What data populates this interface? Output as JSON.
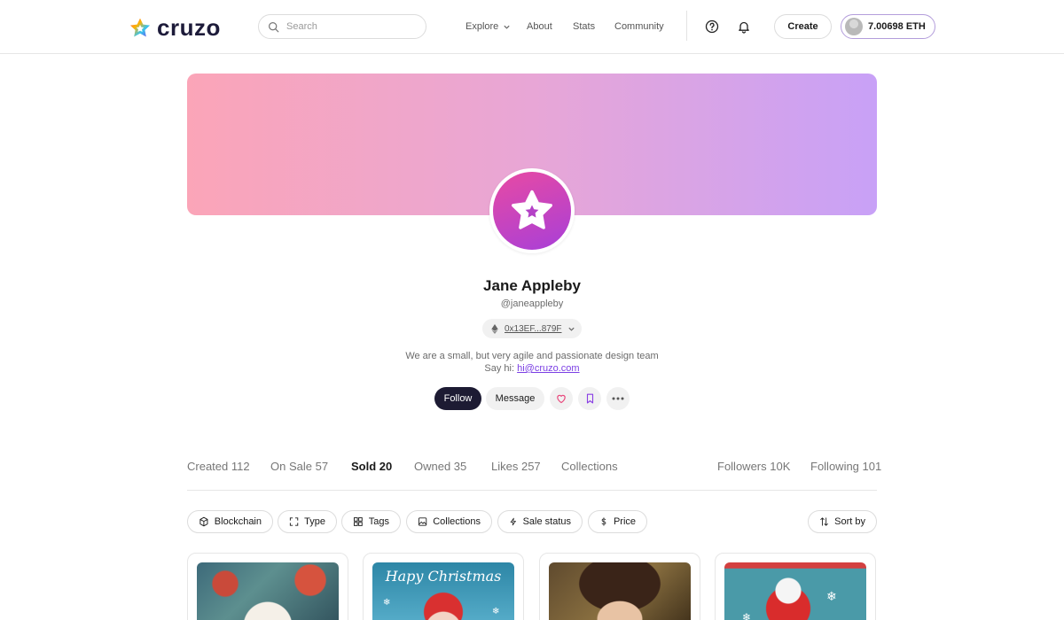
{
  "header": {
    "brand": "cruzo",
    "search_placeholder": "Search",
    "nav": {
      "explore": "Explore",
      "about": "About",
      "stats": "Stats",
      "community": "Community"
    },
    "create_label": "Create",
    "balance": "7.00698 ETH"
  },
  "profile": {
    "name": "Jane Appleby",
    "handle": "@janeappleby",
    "address": "0x13EF...879F",
    "bio_line1": "We are a small, but very agile and passionate design team",
    "bio_say_hi": "Say hi:",
    "email": "hi@cruzo.com",
    "follow_label": "Follow",
    "message_label": "Message"
  },
  "tabs": {
    "created": "Created 112",
    "on_sale": "On Sale 57",
    "sold": "Sold 20",
    "owned": "Owned 35",
    "likes": "Likes 257",
    "collections": "Collections",
    "followers": "Followers 10K",
    "following": "Following 101"
  },
  "filters": {
    "blockchain": "Blockchain",
    "type": "Type",
    "tags": "Tags",
    "collections": "Collections",
    "sale_status": "Sale status",
    "price": "Price",
    "sort_by": "Sort by"
  },
  "cards": {
    "card2_text": "Hapy Christmas"
  },
  "colors": {
    "accent": "#7b3fe4",
    "follow_bg": "#1d1b33",
    "banner_start": "#fba5b8",
    "banner_end": "#c8a1f7",
    "avatar_start": "#e84aa3",
    "avatar_end": "#a83fd8"
  },
  "icons": [
    "search-icon",
    "chevron-down-icon",
    "help-icon",
    "bell-icon",
    "ethereum-icon",
    "heart-icon",
    "bookmark-icon",
    "more-icon",
    "cube-icon",
    "expand-icon",
    "grid-icon",
    "image-icon",
    "bolt-icon",
    "dollar-icon",
    "sort-icon",
    "star-icon"
  ]
}
